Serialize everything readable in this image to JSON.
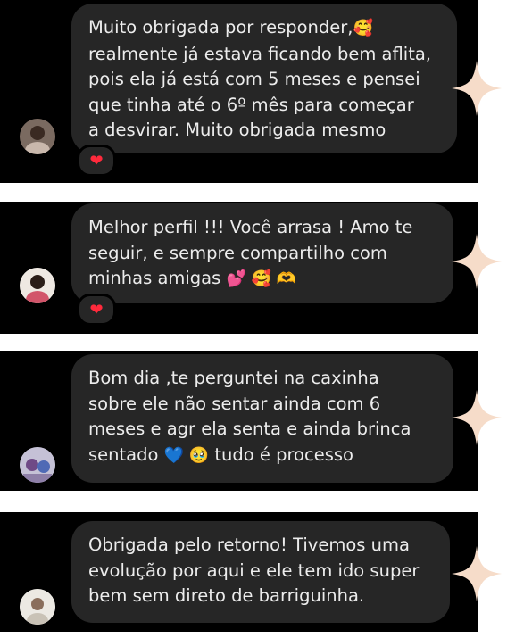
{
  "messages": [
    {
      "lines": [
        "Muito obrigada por responder,",
        "realmente já estava ficando bem aflita,",
        "pois ela já está com 5 meses e pensei",
        "que tinha até o 6º mês para começar",
        "a desvirar. Muito obrigada mesmo"
      ],
      "emoji_after_line0": "🥰",
      "reaction": "❤"
    },
    {
      "lines": [
        "Melhor perfil !!! Você arrasa ! Amo te",
        "seguir, e sempre compartilho com",
        "minhas amigas"
      ],
      "emoji_tail": "💕 🥰 🫶",
      "reaction": "❤"
    },
    {
      "lines": [
        "Bom dia ,te perguntei na caxinha",
        "sobre ele não sentar ainda com 6",
        "meses e agr ela senta e ainda brinca",
        "sentado"
      ],
      "emoji_mid": "💙 🥹",
      "line3_tail": "tudo é processo"
    },
    {
      "lines": [
        "Obrigada pelo retorno! Tivemos uma",
        "evolução por aqui e ele tem ido super",
        "bem sem direto de barriguinha."
      ]
    }
  ],
  "colors": {
    "panel": "#000000",
    "bubble": "#262626",
    "text": "#ececec",
    "sparkle": "#f6dcc9",
    "heart": "#ff2a3c"
  }
}
